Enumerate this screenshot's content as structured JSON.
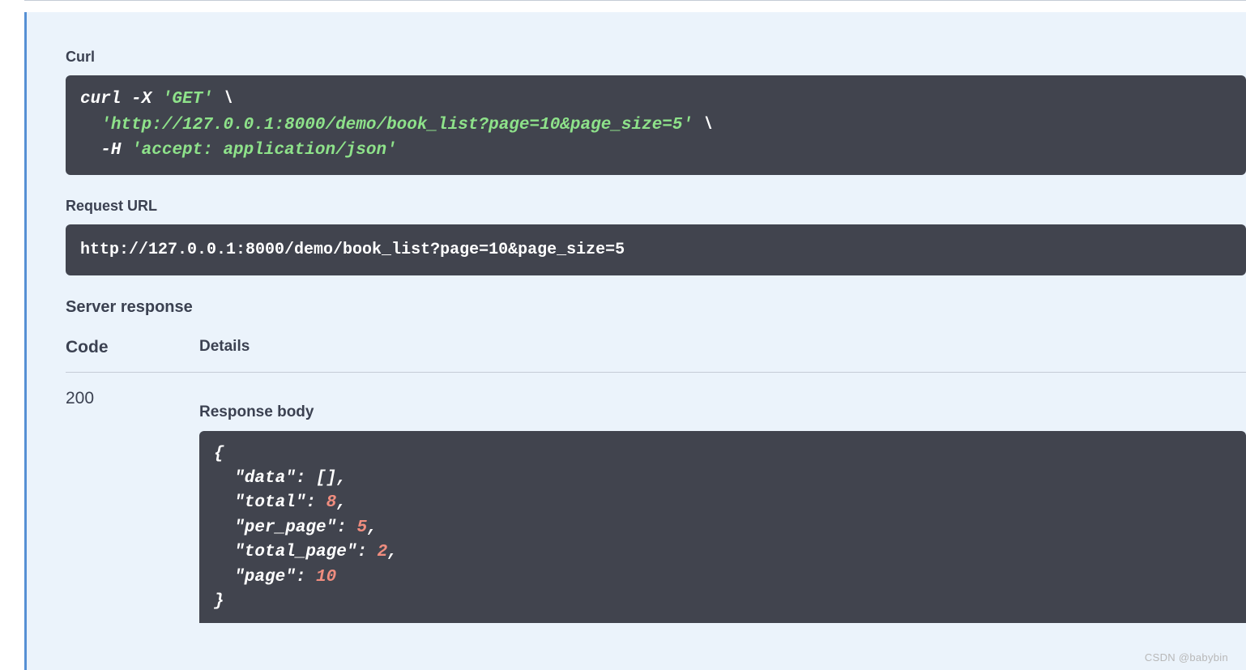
{
  "labels": {
    "curl": "Curl",
    "request_url": "Request URL",
    "server_response": "Server response",
    "code": "Code",
    "details": "Details",
    "response_body": "Response body"
  },
  "curl": {
    "line1_prefix": "curl -X ",
    "line1_method": "'GET'",
    "line1_suffix": " \\",
    "line2_indent": "  ",
    "line2_url": "'http://127.0.0.1:8000/demo/book_list?page=10&page_size=5'",
    "line2_suffix": " \\",
    "line3_indent": "  ",
    "line3_flag": "-H ",
    "line3_header": "'accept: application/json'"
  },
  "request_url": "http://127.0.0.1:8000/demo/book_list?page=10&page_size=5",
  "response": {
    "status_code": "200",
    "body": {
      "open_brace": "{",
      "data_key": "  \"data\"",
      "data_value": "[]",
      "total_key": "  \"total\"",
      "total_value": "8",
      "per_page_key": "  \"per_page\"",
      "per_page_value": "5",
      "total_page_key": "  \"total_page\"",
      "total_page_value": "2",
      "page_key": "  \"page\"",
      "page_value": "10",
      "close_brace": "}",
      "colon_sep": ": ",
      "comma": ","
    }
  },
  "watermark": "CSDN @babybin"
}
